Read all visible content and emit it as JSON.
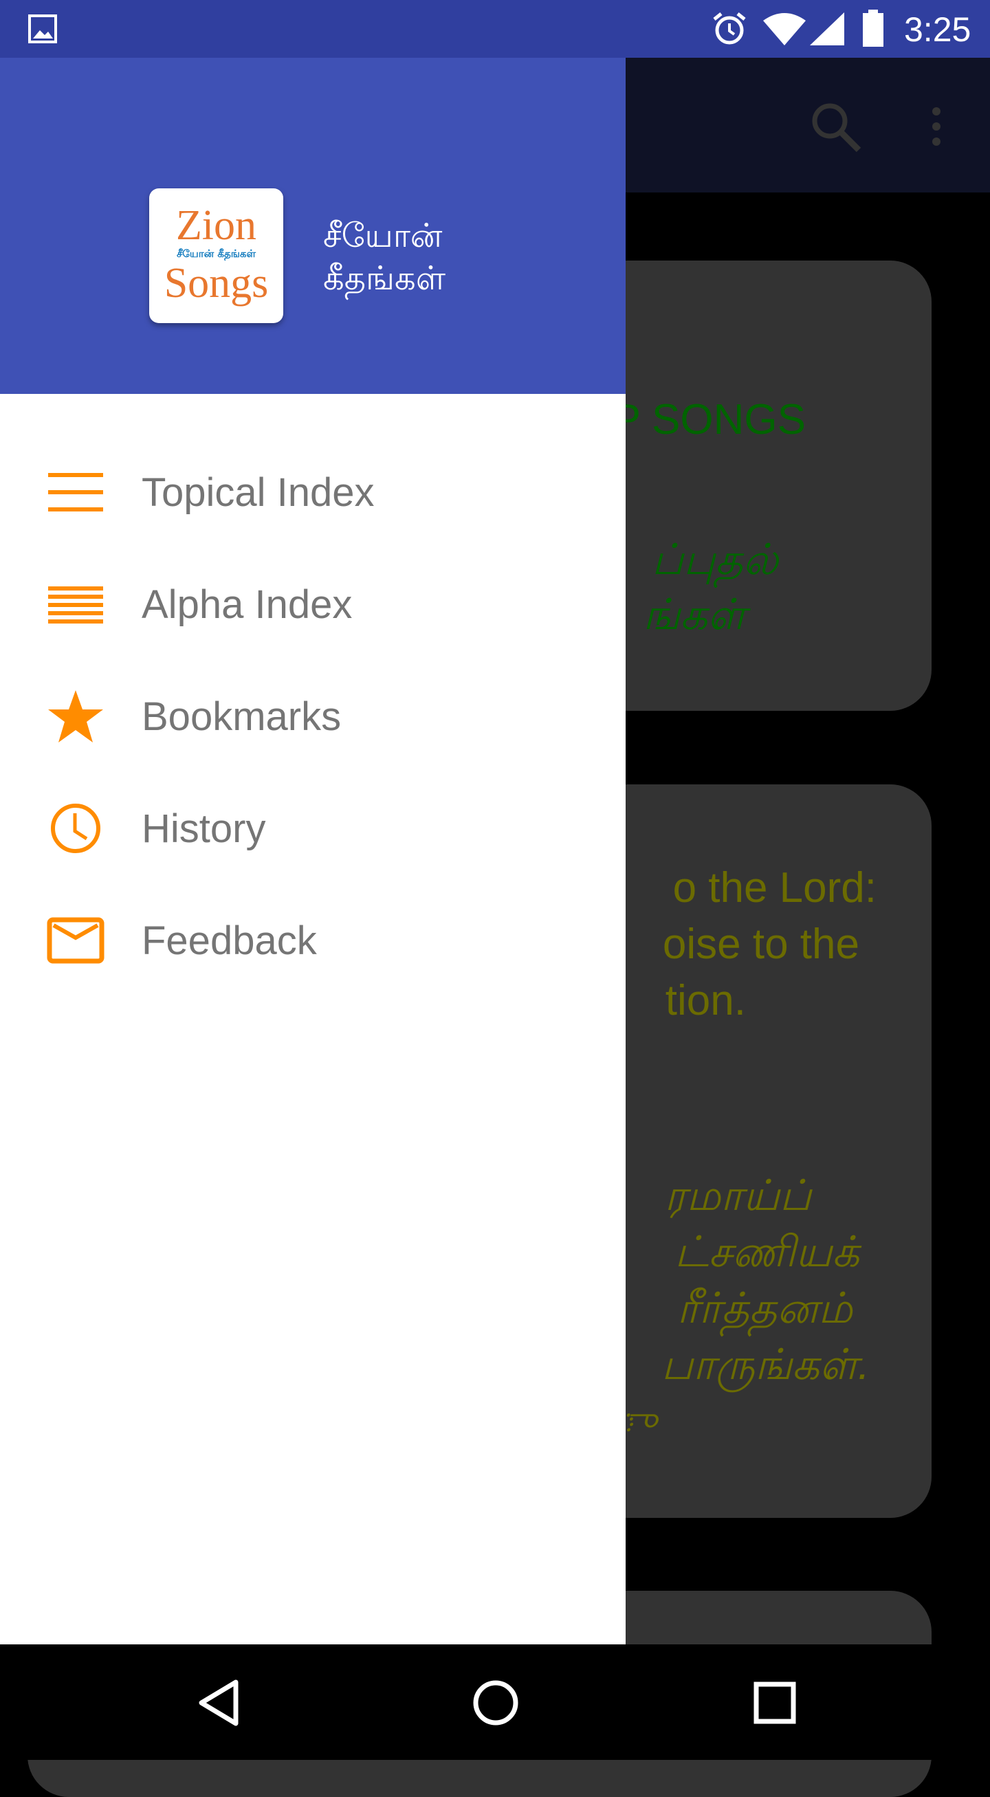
{
  "status_bar": {
    "time": "3:25",
    "icons": [
      "image-icon",
      "alarm-icon",
      "wifi-icon",
      "signal-icon",
      "battery-icon"
    ]
  },
  "toolbar": {
    "icons": [
      "search-icon",
      "more-vert-icon"
    ]
  },
  "content": {
    "card1": {
      "title": "P SONGS",
      "tamil": [
        "ப்புதல்",
        "ங்கள்"
      ]
    },
    "card2": {
      "english": [
        "o the Lord:",
        "oise to the",
        "tion."
      ],
      "tamil": [
        "ரமாய்ப்",
        "ட்சணியக்",
        "ரீர்த்தனம்",
        "பாருங்கள்.",
        "ு"
      ]
    }
  },
  "drawer": {
    "app_title": [
      "சீயோன்",
      "கீதங்கள்"
    ],
    "logo": {
      "line1": "Zion",
      "tamil": "சீயோன் கீதங்கள்",
      "line2": "Songs"
    },
    "items": [
      {
        "label": "Topical Index",
        "icon": "menu-icon"
      },
      {
        "label": "Alpha Index",
        "icon": "list-icon"
      },
      {
        "label": "Bookmarks",
        "icon": "star-icon"
      },
      {
        "label": "History",
        "icon": "clock-icon"
      },
      {
        "label": "Feedback",
        "icon": "mail-icon"
      }
    ]
  },
  "colors": {
    "accent": "#ff8c00",
    "header": "#3f51b5",
    "status": "#303f9f",
    "card_title": "#006400",
    "card_text": "#6b6b00"
  }
}
